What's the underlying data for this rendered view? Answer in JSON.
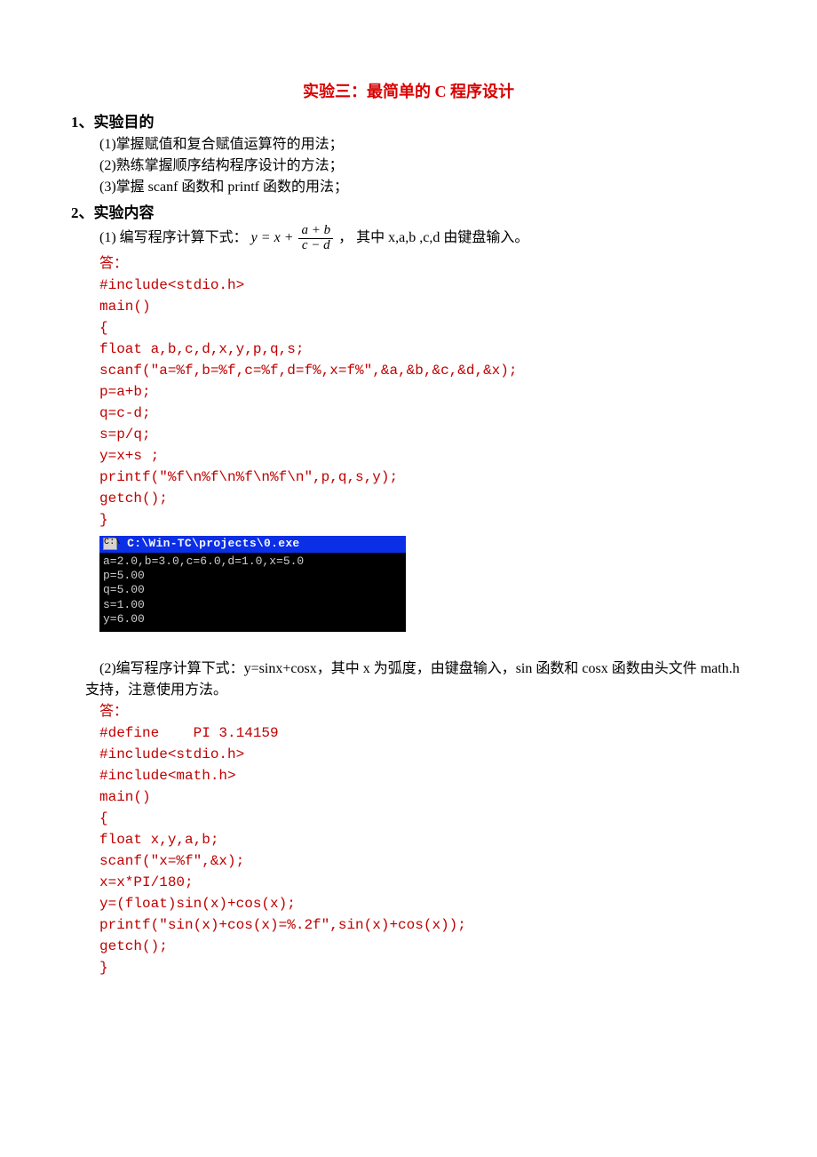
{
  "title": "实验三：最简单的 C 程序设计",
  "section1": {
    "head": "1、实验目的",
    "items": [
      "(1)掌握赋值和复合赋值运算符的用法；",
      "(2)熟练掌握顺序结构程序设计的方法；",
      "(3)掌握 scanf 函数和 printf 函数的用法；"
    ]
  },
  "section2": {
    "head": "2、实验内容",
    "q1": {
      "prefix": "(1) 编写程序计算下式：",
      "formula": {
        "lhs": "y",
        "eq": " = ",
        "x": "x",
        "plus": " + ",
        "frac_num": "a + b",
        "frac_den": "c − d"
      },
      "suffix": "， 其中 x,a,b ,c,d 由键盘输入。",
      "answer_label": "答：",
      "code": "#include<stdio.h>\nmain()\n{\nfloat a,b,c,d,x,y,p,q,s;\nscanf(\"a=%f,b=%f,c=%f,d=f%,x=f%\",&a,&b,&c,&d,&x);\np=a+b;\nq=c-d;\ns=p/q;\ny=x+s ;\nprintf(\"%f\\n%f\\n%f\\n%f\\n\",p,q,s,y);\ngetch();\n}",
      "console": {
        "title_icon": "C:\\",
        "title": " C:\\Win-TC\\projects\\0.exe",
        "body": "a=2.0,b=3.0,c=6.0,d=1.0,x=5.0\np=5.00\nq=5.00\ns=1.00\ny=6.00"
      }
    },
    "q2": {
      "text": "(2)编写程序计算下式：y=sinx+cosx，其中 x  为弧度，由键盘输入，sin 函数和 cosx 函数由头文件 math.h 支持，注意使用方法。",
      "answer_label": "答：",
      "code": "#define    PI 3.14159\n#include<stdio.h>\n#include<math.h>\nmain()\n{\nfloat x,y,a,b;\nscanf(\"x=%f\",&x);\nx=x*PI/180;\ny=(float)sin(x)+cos(x);\nprintf(\"sin(x)+cos(x)=%.2f\",sin(x)+cos(x));\ngetch();\n}"
    }
  }
}
